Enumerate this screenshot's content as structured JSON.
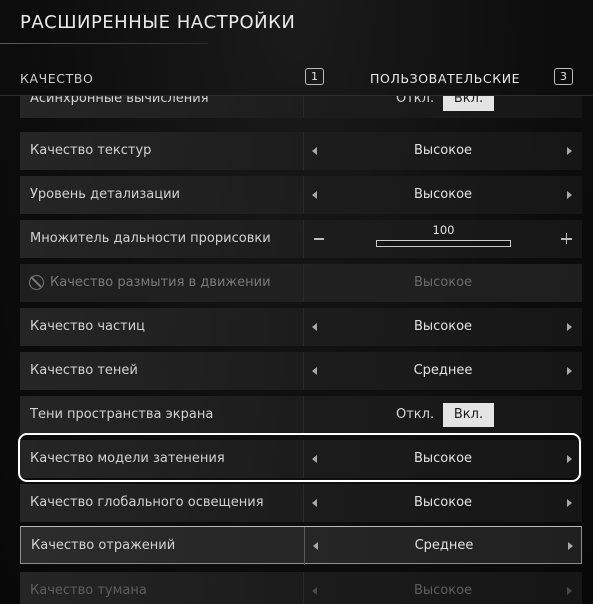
{
  "header": {
    "title": "РАСШИРЕННЫЕ НАСТРОЙКИ"
  },
  "tabs": {
    "left_label": "КАЧЕСТВО",
    "left_key": "1",
    "center_label": "ПОЛЬЗОВАТЕЛЬСКИЕ",
    "right_key": "3"
  },
  "settings": [
    {
      "label": "Асинхронные вычисления",
      "type": "toggle",
      "off_label": "Откл.",
      "on_label": "Вкл.",
      "value": "Вкл."
    },
    {
      "label": "Качество текстур",
      "type": "select",
      "value": "Высокое"
    },
    {
      "label": "Уровень детализации",
      "type": "select",
      "value": "Высокое"
    },
    {
      "label": "Множитель дальности прорисовки",
      "type": "slider",
      "value": "100",
      "level": 0
    },
    {
      "label": "Качество размытия в движении",
      "type": "disabled",
      "value": "Высокое"
    },
    {
      "label": "Качество частиц",
      "type": "select",
      "value": "Высокое"
    },
    {
      "label": "Качество теней",
      "type": "select",
      "value": "Среднее"
    },
    {
      "label": "Тени пространства экрана",
      "type": "toggle",
      "off_label": "Откл.",
      "on_label": "Вкл.",
      "value": "Вкл."
    },
    {
      "label": "Качество модели затенения",
      "type": "select",
      "value": "Высокое"
    },
    {
      "label": "Качество глобального освещения",
      "type": "select",
      "value": "Высокое"
    },
    {
      "label": "Качество отражений",
      "type": "select",
      "value": "Среднее"
    },
    {
      "label": "Качество тумана",
      "type": "select",
      "value": "Высокое"
    }
  ],
  "colors": {
    "accent": "#e4e4e4",
    "highlight": "#ffffff",
    "disabled": "#7a7a7a"
  }
}
